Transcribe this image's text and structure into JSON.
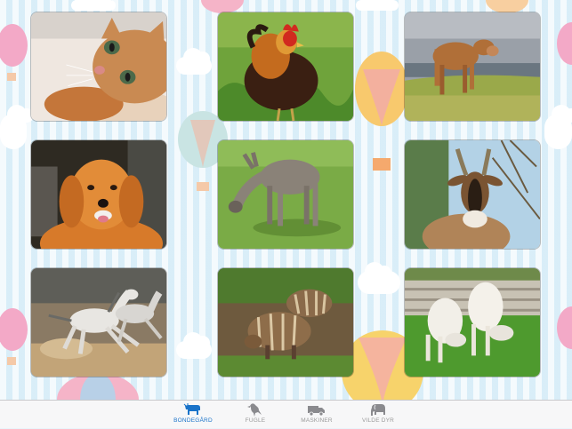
{
  "tiles": [
    {
      "name": "cat",
      "icon": "cat-photo"
    },
    {
      "name": "rooster",
      "icon": "rooster-photo"
    },
    {
      "name": "cow",
      "icon": "cow-photo"
    },
    {
      "name": "dog",
      "icon": "dog-photo"
    },
    {
      "name": "donkey",
      "icon": "donkey-photo"
    },
    {
      "name": "goat",
      "icon": "goat-photo"
    },
    {
      "name": "horses",
      "icon": "horses-photo"
    },
    {
      "name": "piglets",
      "icon": "piglets-photo"
    },
    {
      "name": "lambs",
      "icon": "lambs-photo"
    }
  ],
  "tabbar": {
    "tabs": [
      {
        "label": "BONDEGÅRD",
        "icon": "cow-icon",
        "active": true
      },
      {
        "label": "FUGLE",
        "icon": "bird-icon",
        "active": false
      },
      {
        "label": "MASKINER",
        "icon": "truck-icon",
        "active": false
      },
      {
        "label": "VILDE DYR",
        "icon": "elephant-icon",
        "active": false
      }
    ],
    "active_color": "#1a73c9",
    "inactive_color": "#9a9a9a"
  }
}
